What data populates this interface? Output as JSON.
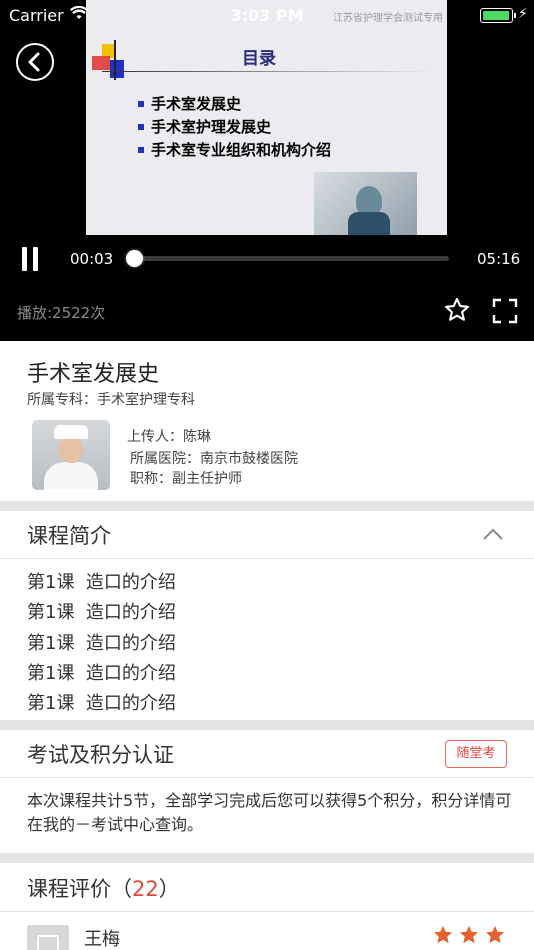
{
  "status_bar": {
    "carrier": "Carrier",
    "time": "3:03 PM",
    "battery_level": 1.0,
    "battery_color": "#4cd964"
  },
  "video": {
    "slide": {
      "watermark": "江苏省护理学会测试专用",
      "title": "目录",
      "items": [
        "手术室发展史",
        "手术室护理发展史",
        "手术室专业组织和机构介绍"
      ]
    },
    "current_time": "00:03",
    "total_time": "05:16",
    "progress": 0.01,
    "play_count": "播放:2522次",
    "icons": [
      "back-icon",
      "pause-icon",
      "star-outline-icon",
      "fullscreen-icon"
    ]
  },
  "course": {
    "title": "手术室发展史",
    "specialty": "所属专科：手术室护理专科",
    "uploader": "上传人：陈琳",
    "hospital": "所属医院：南京市鼓楼医院",
    "position": "职称：副主任护师"
  },
  "intro": {
    "heading": "课程简介",
    "lessons": [
      "第1课  造口的介绍",
      "第1课  造口的介绍",
      "第1课  造口的介绍",
      "第1课  造口的介绍",
      "第1课  造口的介绍"
    ]
  },
  "exam": {
    "heading": "考试及积分认证",
    "button": "随堂考",
    "description": "本次课程共计5节，全部学习完成后您可以获得5个积分，积分详情可在我的－考试中心查询。",
    "accent": "#e0463a"
  },
  "reviews": {
    "heading": "课程评价（",
    "count": "22",
    "heading_end": "）",
    "first": {
      "name": "王梅",
      "stars": 3,
      "star_color": "#e2622e"
    }
  }
}
